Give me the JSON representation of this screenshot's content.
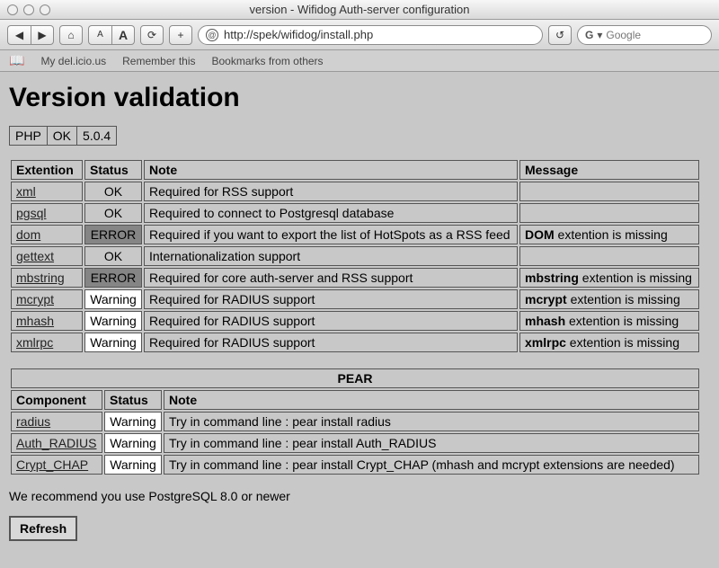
{
  "window": {
    "title": "version - Wifidog Auth-server configuration"
  },
  "toolbar": {
    "back": "◀",
    "forward": "▶",
    "home": "⌂",
    "textsize_small": "A",
    "textsize_large": "A",
    "reload": "⟳",
    "add": "+",
    "url": "http://spek/wifidog/install.php",
    "snapback": "↺",
    "search_engine": "G",
    "search_placeholder": "Google"
  },
  "bookmarks": {
    "icon": "📖",
    "items": [
      "My del.icio.us",
      "Remember this",
      "Bookmarks from others"
    ]
  },
  "page": {
    "heading": "Version validation",
    "php": {
      "label": "PHP",
      "status": "OK",
      "version": "5.0.4"
    },
    "ext_headers": {
      "ext": "Extention",
      "status": "Status",
      "note": "Note",
      "msg": "Message"
    },
    "extensions": [
      {
        "name": "xml",
        "status": "OK",
        "note": "Required for RSS support",
        "msg": ""
      },
      {
        "name": "pgsql",
        "status": "OK",
        "note": "Required to connect to Postgresql database",
        "msg": ""
      },
      {
        "name": "dom",
        "status": "ERROR",
        "note": "Required if you want to export the list of HotSpots as a RSS feed",
        "msg_bold": "DOM",
        "msg_rest": " extention is missing"
      },
      {
        "name": "gettext",
        "status": "OK",
        "note": "Internationalization support",
        "msg": ""
      },
      {
        "name": "mbstring",
        "status": "ERROR",
        "note": "Required for core auth-server and RSS support",
        "msg_bold": "mbstring",
        "msg_rest": " extention is missing"
      },
      {
        "name": "mcrypt",
        "status": "Warning",
        "note": "Required for RADIUS support",
        "msg_bold": "mcrypt",
        "msg_rest": " extention is missing"
      },
      {
        "name": "mhash",
        "status": "Warning",
        "note": "Required for RADIUS support",
        "msg_bold": "mhash",
        "msg_rest": " extention is missing"
      },
      {
        "name": "xmlrpc",
        "status": "Warning",
        "note": "Required for RADIUS support",
        "msg_bold": "xmlrpc",
        "msg_rest": " extention is missing"
      }
    ],
    "pear": {
      "title": "PEAR",
      "headers": {
        "comp": "Component",
        "status": "Status",
        "note": "Note"
      },
      "rows": [
        {
          "name": "radius",
          "status": "Warning",
          "note": "Try in command line : pear install radius"
        },
        {
          "name": "Auth_RADIUS",
          "status": "Warning",
          "note": "Try in command line : pear install Auth_RADIUS"
        },
        {
          "name": "Crypt_CHAP",
          "status": "Warning",
          "note": "Try in command line : pear install Crypt_CHAP (mhash and mcrypt extensions are needed)"
        }
      ]
    },
    "recommend": "We recommend you use PostgreSQL 8.0 or newer",
    "refresh": "Refresh"
  }
}
